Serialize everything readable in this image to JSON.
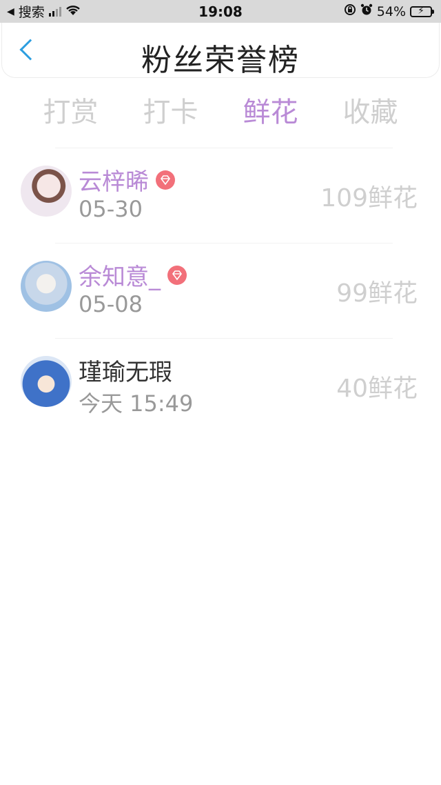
{
  "status_bar": {
    "back_app": "搜索",
    "time": "19:08",
    "battery": "54%",
    "battery_level": 0.54,
    "colors": {
      "battery_fill": "#4cd964"
    }
  },
  "header": {
    "title": "粉丝荣誉榜",
    "back_icon": "chevron-left-icon",
    "accent": "#2d9ee0"
  },
  "tabs": [
    {
      "label": "打赏",
      "active": false
    },
    {
      "label": "打卡",
      "active": false
    },
    {
      "label": "鲜花",
      "active": true
    },
    {
      "label": "收藏",
      "active": false
    }
  ],
  "theme": {
    "active_color": "#b98ad6",
    "badge_color": "#f2707a"
  },
  "fans": [
    {
      "name": "云梓晞",
      "date": "05-30",
      "amount": "109鲜花",
      "badge": "diamond-icon"
    },
    {
      "name": "余知意_",
      "date": "05-08",
      "amount": "99鲜花",
      "badge": "diamond-icon"
    },
    {
      "name": "瑾瑜无瑕",
      "date": "今天 15:49",
      "amount": "40鲜花",
      "badge": null
    }
  ]
}
